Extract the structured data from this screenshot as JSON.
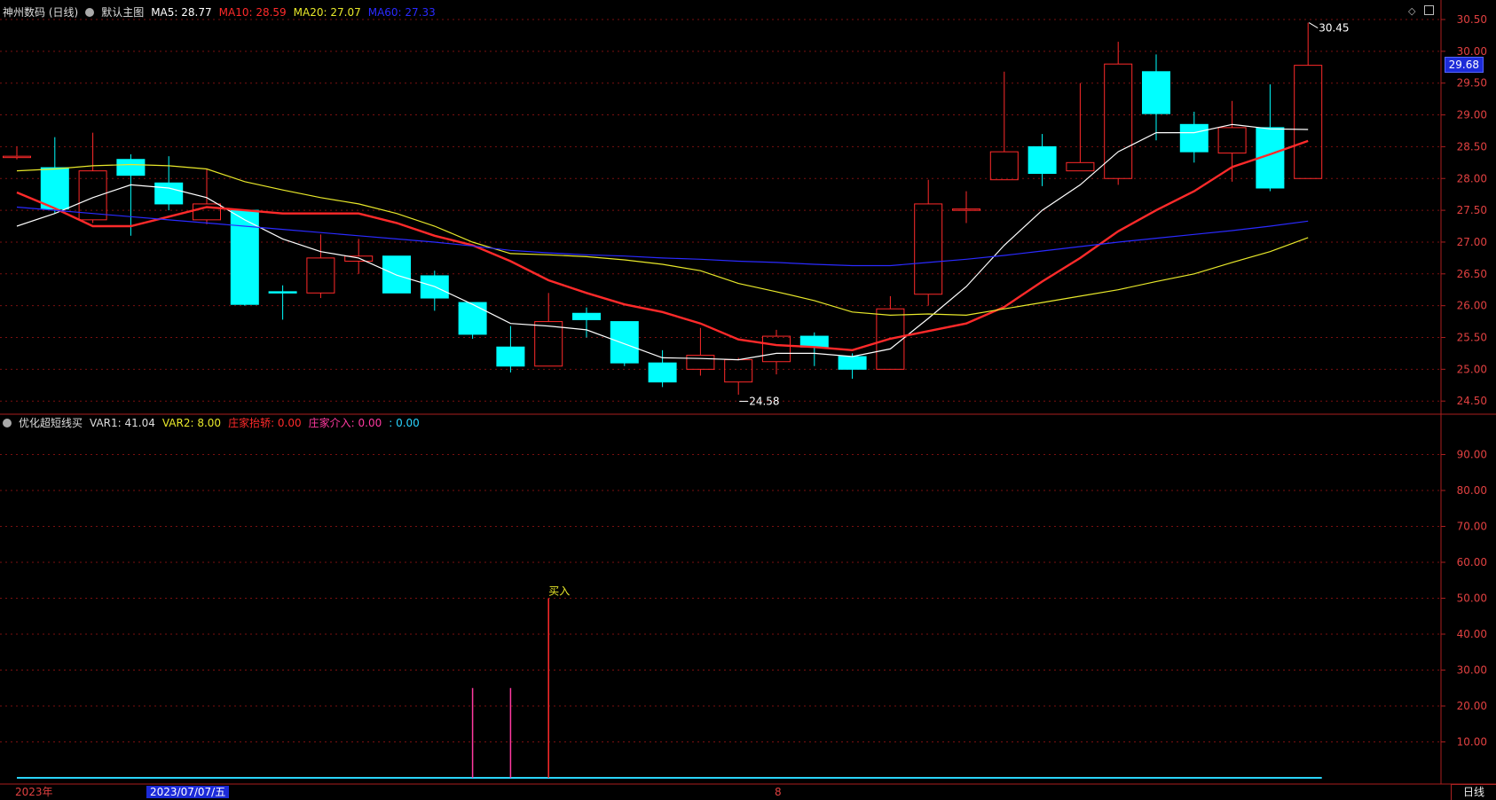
{
  "header": {
    "stock": "神州数码 (日线)",
    "main_label": "默认主图",
    "ma": [
      {
        "label": "MA5: 28.77",
        "color": "#ffffff"
      },
      {
        "label": "MA10: 28.59",
        "color": "#ff2a2a"
      },
      {
        "label": "MA20: 27.07",
        "color": "#e8e82a"
      },
      {
        "label": "MA60: 27.33",
        "color": "#2a2aff"
      }
    ]
  },
  "indicator_header": {
    "name": "优化超短线买",
    "items": [
      {
        "label": "VAR1: 41.04",
        "color": "#dddddd"
      },
      {
        "label": "VAR2: 8.00",
        "color": "#e8e82a"
      },
      {
        "label": "庄家抬轿: 0.00",
        "color": "#ff2a2a"
      },
      {
        "label": "庄家介入: 0.00",
        "color": "#ff3aa0"
      },
      {
        "label": ": 0.00",
        "color": "#2ad4ff"
      }
    ]
  },
  "current_price": "29.68",
  "date_highlight": "2023/07/07/五",
  "period_label": "日线",
  "top_icons": [
    "diamond-icon",
    "window-icon"
  ],
  "chart_data": [
    {
      "type": "candlestick",
      "title": "",
      "ylim": [
        24.3,
        30.65
      ],
      "yticks": [
        "30.50",
        "30.00",
        "29.50",
        "29.00",
        "28.50",
        "28.00",
        "27.50",
        "27.00",
        "26.50",
        "26.00",
        "25.50",
        "25.00",
        "24.50"
      ],
      "xlabels": [
        {
          "text": "2023年",
          "index": 0
        },
        {
          "text": "8",
          "index": 20
        }
      ],
      "high_marker": {
        "text": "30.45",
        "index": 34,
        "value": 30.45
      },
      "low_marker": {
        "text": "24.58",
        "index": 19,
        "value": 24.58
      },
      "colors": {
        "up": "#ff2a2a",
        "down": "#00ffff"
      },
      "candles": [
        {
          "o": 28.33,
          "h": 28.5,
          "l": 28.3,
          "c": 28.35
        },
        {
          "o": 28.17,
          "h": 28.65,
          "l": 27.45,
          "c": 27.52
        },
        {
          "o": 27.35,
          "h": 28.72,
          "l": 27.3,
          "c": 28.12
        },
        {
          "o": 28.3,
          "h": 28.38,
          "l": 27.1,
          "c": 28.05
        },
        {
          "o": 27.93,
          "h": 28.35,
          "l": 27.5,
          "c": 27.6
        },
        {
          "o": 27.35,
          "h": 28.15,
          "l": 27.28,
          "c": 27.6
        },
        {
          "o": 27.5,
          "h": 27.5,
          "l": 26.0,
          "c": 26.02
        },
        {
          "o": 26.22,
          "h": 26.32,
          "l": 25.78,
          "c": 26.2
        },
        {
          "o": 26.2,
          "h": 27.12,
          "l": 26.12,
          "c": 26.75
        },
        {
          "o": 26.7,
          "h": 27.05,
          "l": 26.5,
          "c": 26.78
        },
        {
          "o": 26.78,
          "h": 26.78,
          "l": 26.2,
          "c": 26.2
        },
        {
          "o": 26.47,
          "h": 26.55,
          "l": 25.92,
          "c": 26.12
        },
        {
          "o": 26.05,
          "h": 26.05,
          "l": 25.48,
          "c": 25.55
        },
        {
          "o": 25.35,
          "h": 25.68,
          "l": 24.95,
          "c": 25.05
        },
        {
          "o": 25.05,
          "h": 26.2,
          "l": 25.05,
          "c": 25.75
        },
        {
          "o": 25.88,
          "h": 25.97,
          "l": 25.5,
          "c": 25.78
        },
        {
          "o": 25.75,
          "h": 25.75,
          "l": 25.05,
          "c": 25.1
        },
        {
          "o": 25.1,
          "h": 25.3,
          "l": 24.72,
          "c": 24.8
        },
        {
          "o": 25.0,
          "h": 25.65,
          "l": 24.9,
          "c": 25.22
        },
        {
          "o": 24.8,
          "h": 25.18,
          "l": 24.6,
          "c": 25.15
        },
        {
          "o": 25.12,
          "h": 25.62,
          "l": 24.92,
          "c": 25.52
        },
        {
          "o": 25.52,
          "h": 25.58,
          "l": 25.05,
          "c": 25.35
        },
        {
          "o": 25.2,
          "h": 25.25,
          "l": 24.85,
          "c": 25.0
        },
        {
          "o": 25.0,
          "h": 26.15,
          "l": 25.0,
          "c": 25.95
        },
        {
          "o": 26.18,
          "h": 27.98,
          "l": 26.0,
          "c": 27.6
        },
        {
          "o": 27.5,
          "h": 27.8,
          "l": 27.3,
          "c": 27.52
        },
        {
          "o": 27.98,
          "h": 29.68,
          "l": 27.98,
          "c": 28.42
        },
        {
          "o": 28.5,
          "h": 28.7,
          "l": 27.88,
          "c": 28.08
        },
        {
          "o": 28.12,
          "h": 29.5,
          "l": 28.12,
          "c": 28.25
        },
        {
          "o": 28.0,
          "h": 30.15,
          "l": 27.9,
          "c": 29.8
        },
        {
          "o": 29.68,
          "h": 29.95,
          "l": 28.6,
          "c": 29.02
        },
        {
          "o": 28.85,
          "h": 29.05,
          "l": 28.25,
          "c": 28.42
        },
        {
          "o": 28.4,
          "h": 29.22,
          "l": 27.95,
          "c": 28.8
        },
        {
          "o": 28.8,
          "h": 29.48,
          "l": 27.8,
          "c": 27.85
        },
        {
          "o": 28.0,
          "h": 30.45,
          "l": 28.0,
          "c": 29.78
        }
      ],
      "series": [
        {
          "name": "MA5",
          "color": "#ffffff",
          "width": 1.2,
          "values": [
            27.25,
            27.45,
            27.7,
            27.9,
            27.85,
            27.7,
            27.35,
            27.05,
            26.85,
            26.75,
            26.48,
            26.3,
            26.02,
            25.72,
            25.68,
            25.62,
            25.4,
            25.18,
            25.17,
            25.15,
            25.25,
            25.25,
            25.2,
            25.32,
            25.8,
            26.3,
            26.95,
            27.5,
            27.9,
            28.42,
            28.72,
            28.72,
            28.85,
            28.78,
            28.77
          ]
        },
        {
          "name": "MA10",
          "color": "#ff2a2a",
          "width": 2.4,
          "values": [
            27.78,
            27.53,
            27.25,
            27.25,
            27.4,
            27.55,
            27.5,
            27.45,
            27.45,
            27.45,
            27.3,
            27.1,
            26.95,
            26.7,
            26.4,
            26.2,
            26.02,
            25.9,
            25.72,
            25.47,
            25.38,
            25.35,
            25.3,
            25.48,
            25.6,
            25.72,
            25.98,
            26.38,
            26.75,
            27.17,
            27.5,
            27.8,
            28.18,
            28.38,
            28.59
          ]
        },
        {
          "name": "MA20",
          "color": "#e8e82a",
          "width": 1.2,
          "values": [
            28.12,
            28.15,
            28.2,
            28.22,
            28.2,
            28.15,
            27.95,
            27.82,
            27.7,
            27.6,
            27.45,
            27.25,
            27.0,
            26.82,
            26.8,
            26.77,
            26.72,
            26.65,
            26.55,
            26.35,
            26.22,
            26.08,
            25.9,
            25.85,
            25.87,
            25.85,
            25.95,
            26.05,
            26.15,
            26.25,
            26.38,
            26.5,
            26.68,
            26.85,
            27.07
          ]
        },
        {
          "name": "MA60",
          "color": "#2a2aff",
          "width": 1.2,
          "values": [
            27.55,
            27.5,
            27.45,
            27.4,
            27.35,
            27.3,
            27.25,
            27.2,
            27.15,
            27.1,
            27.05,
            27.0,
            26.94,
            26.87,
            26.83,
            26.8,
            26.78,
            26.75,
            26.73,
            26.7,
            26.68,
            26.65,
            26.63,
            26.63,
            26.68,
            26.73,
            26.79,
            26.86,
            26.93,
            27.0,
            27.06,
            27.12,
            27.18,
            27.25,
            27.33
          ]
        }
      ]
    },
    {
      "type": "bar",
      "title": "",
      "ylim": [
        0,
        100
      ],
      "yticks": [
        "90.00",
        "80.00",
        "70.00",
        "60.00",
        "50.00",
        "40.00",
        "30.00",
        "20.00",
        "10.00"
      ],
      "bars": [
        {
          "index": 12,
          "value": 25,
          "color": "#ff3aa0"
        },
        {
          "index": 13,
          "value": 25,
          "color": "#ff3aa0"
        },
        {
          "index": 14,
          "value": 50,
          "color": "#ff2a2a",
          "label": "买入",
          "label_color": "#e8e82a"
        }
      ],
      "baseline": {
        "value": 0,
        "color": "#2ad4ff"
      }
    }
  ]
}
